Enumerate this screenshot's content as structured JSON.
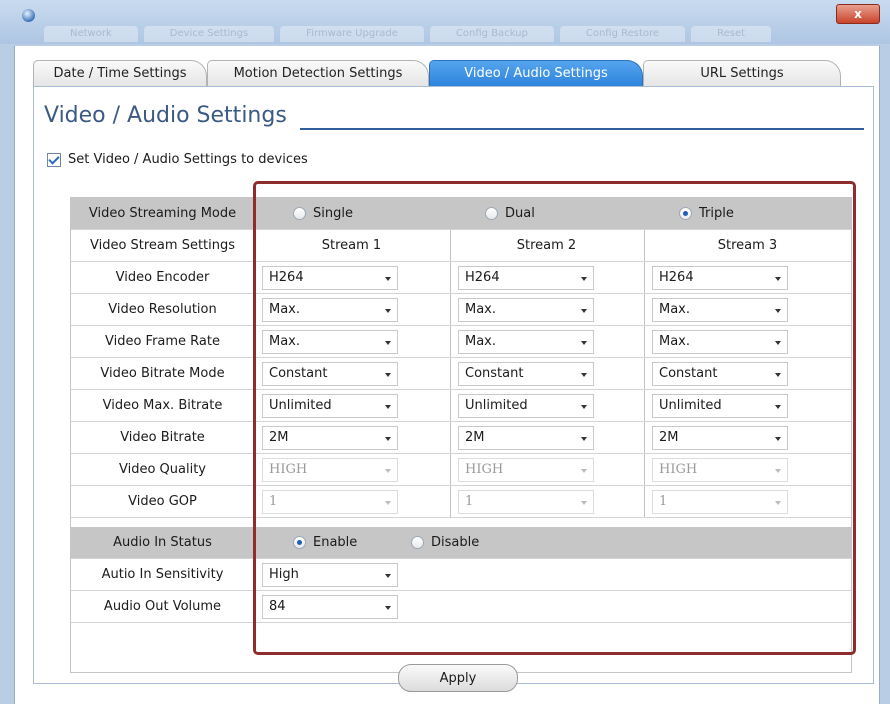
{
  "window": {
    "close_glyph": "x"
  },
  "background_tabs": [
    "Network",
    "Device Settings",
    "Firmware Upgrade",
    "Config Backup",
    "Config Restore",
    "Reset"
  ],
  "tabs": [
    {
      "label": "Date / Time Settings",
      "active": false
    },
    {
      "label": "Motion Detection Settings",
      "active": false
    },
    {
      "label": "Video / Audio Settings",
      "active": true
    },
    {
      "label": "URL Settings",
      "active": false
    }
  ],
  "panel": {
    "title": "Video / Audio Settings",
    "apply_to_devices_label": "Set Video / Audio Settings to devices",
    "apply_to_devices_checked": true
  },
  "video": {
    "streaming_mode": {
      "label": "Video Streaming Mode",
      "options": [
        {
          "label": "Single",
          "selected": false
        },
        {
          "label": "Dual",
          "selected": false
        },
        {
          "label": "Triple",
          "selected": true
        }
      ]
    },
    "stream_settings_label": "Video Stream Settings",
    "streams": [
      "Stream 1",
      "Stream 2",
      "Stream 3"
    ],
    "rows": [
      {
        "label": "Video Encoder",
        "values": [
          "H264",
          "H264",
          "H264"
        ],
        "enabled": true
      },
      {
        "label": "Video Resolution",
        "values": [
          "Max.",
          "Max.",
          "Max."
        ],
        "enabled": true
      },
      {
        "label": "Video Frame Rate",
        "values": [
          "Max.",
          "Max.",
          "Max."
        ],
        "enabled": true
      },
      {
        "label": "Video Bitrate Mode",
        "values": [
          "Constant",
          "Constant",
          "Constant"
        ],
        "enabled": true
      },
      {
        "label": "Video Max. Bitrate",
        "values": [
          "Unlimited",
          "Unlimited",
          "Unlimited"
        ],
        "enabled": true
      },
      {
        "label": "Video Bitrate",
        "values": [
          "2M",
          "2M",
          "2M"
        ],
        "enabled": true
      },
      {
        "label": "Video Quality",
        "values": [
          "HIGH",
          "HIGH",
          "HIGH"
        ],
        "enabled": false
      },
      {
        "label": "Video GOP",
        "values": [
          "1",
          "1",
          "1"
        ],
        "enabled": false
      }
    ]
  },
  "audio": {
    "in_status": {
      "label": "Audio In Status",
      "options": [
        {
          "label": "Enable",
          "selected": true
        },
        {
          "label": "Disable",
          "selected": false
        }
      ]
    },
    "in_sensitivity": {
      "label": "Autio In Sensitivity",
      "value": "High"
    },
    "out_volume": {
      "label": "Audio Out Volume",
      "value": "84"
    }
  },
  "apply_button": "Apply",
  "colors": {
    "active_tab": "#3a8fe2",
    "highlight_border": "#8e2d2d",
    "section_header": "#c6c6c6"
  }
}
